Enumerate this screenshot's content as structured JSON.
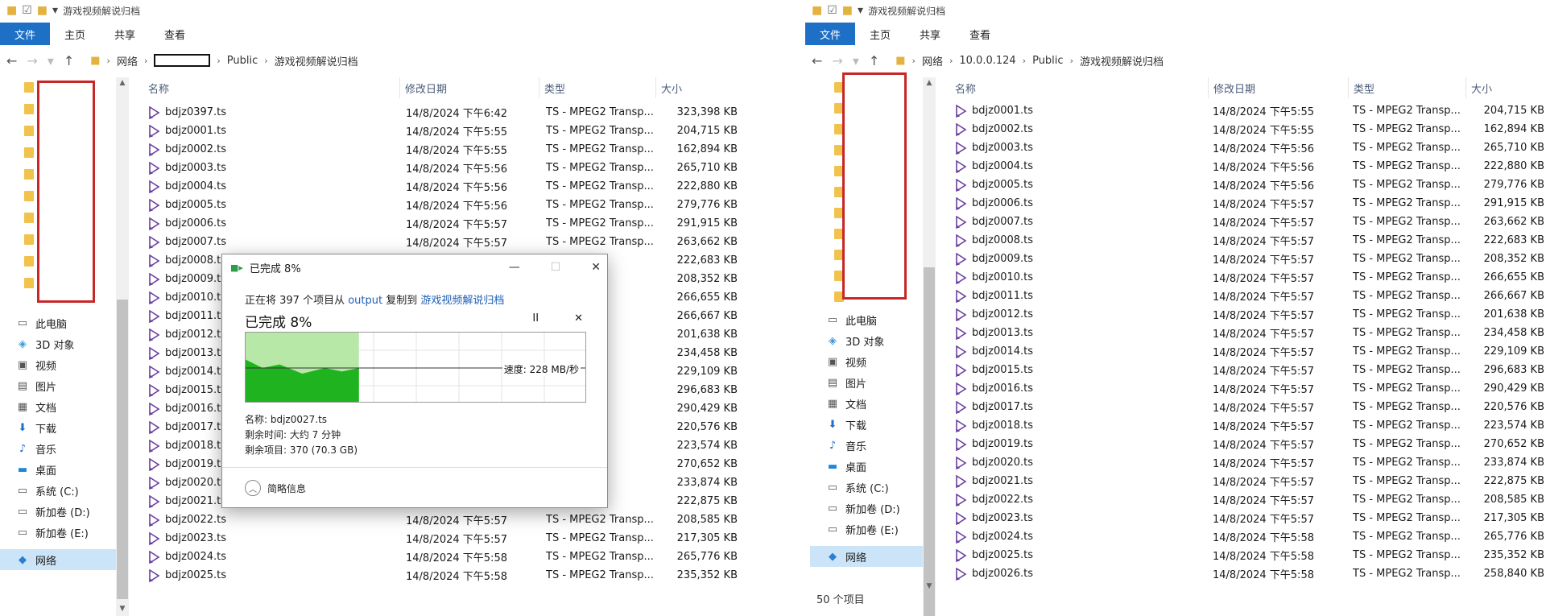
{
  "left": {
    "title": "游戏视频解说归档",
    "tabs": [
      "文件",
      "主页",
      "共享",
      "查看"
    ],
    "crumbs": [
      "网络",
      "Public",
      "游戏视频解说归档"
    ],
    "columns": {
      "name": "名称",
      "date": "修改日期",
      "type": "类型",
      "size": "大小"
    },
    "files": [
      {
        "name": "bdjz0397.ts",
        "date": "14/8/2024 下午6:42",
        "type": "TS - MPEG2 Transp...",
        "size": "323,398 KB"
      },
      {
        "name": "bdjz0001.ts",
        "date": "14/8/2024 下午5:55",
        "type": "TS - MPEG2 Transp...",
        "size": "204,715 KB"
      },
      {
        "name": "bdjz0002.ts",
        "date": "14/8/2024 下午5:55",
        "type": "TS - MPEG2 Transp...",
        "size": "162,894 KB"
      },
      {
        "name": "bdjz0003.ts",
        "date": "14/8/2024 下午5:56",
        "type": "TS - MPEG2 Transp...",
        "size": "265,710 KB"
      },
      {
        "name": "bdjz0004.ts",
        "date": "14/8/2024 下午5:56",
        "type": "TS - MPEG2 Transp...",
        "size": "222,880 KB"
      },
      {
        "name": "bdjz0005.ts",
        "date": "14/8/2024 下午5:56",
        "type": "TS - MPEG2 Transp...",
        "size": "279,776 KB"
      },
      {
        "name": "bdjz0006.ts",
        "date": "14/8/2024 下午5:57",
        "type": "TS - MPEG2 Transp...",
        "size": "291,915 KB"
      },
      {
        "name": "bdjz0007.ts",
        "date": "14/8/2024 下午5:57",
        "type": "TS - MPEG2 Transp...",
        "size": "263,662 KB"
      },
      {
        "name": "bdjz0008.ts",
        "date": "",
        "type": "",
        "size": "222,683 KB"
      },
      {
        "name": "bdjz0009.ts",
        "date": "",
        "type": "",
        "size": "208,352 KB"
      },
      {
        "name": "bdjz0010.ts",
        "date": "",
        "type": "",
        "size": "266,655 KB"
      },
      {
        "name": "bdjz0011.ts",
        "date": "",
        "type": "",
        "size": "266,667 KB"
      },
      {
        "name": "bdjz0012.ts",
        "date": "",
        "type": "",
        "size": "201,638 KB"
      },
      {
        "name": "bdjz0013.ts",
        "date": "",
        "type": "",
        "size": "234,458 KB"
      },
      {
        "name": "bdjz0014.ts",
        "date": "",
        "type": "",
        "size": "229,109 KB"
      },
      {
        "name": "bdjz0015.ts",
        "date": "",
        "type": "",
        "size": "296,683 KB"
      },
      {
        "name": "bdjz0016.ts",
        "date": "",
        "type": "",
        "size": "290,429 KB"
      },
      {
        "name": "bdjz0017.ts",
        "date": "",
        "type": "",
        "size": "220,576 KB"
      },
      {
        "name": "bdjz0018.ts",
        "date": "",
        "type": "",
        "size": "223,574 KB"
      },
      {
        "name": "bdjz0019.ts",
        "date": "",
        "type": "",
        "size": "270,652 KB"
      },
      {
        "name": "bdjz0020.ts",
        "date": "",
        "type": "",
        "size": "233,874 KB"
      },
      {
        "name": "bdjz0021.ts",
        "date": "",
        "type": "",
        "size": "222,875 KB"
      },
      {
        "name": "bdjz0022.ts",
        "date": "14/8/2024 下午5:57",
        "type": "TS - MPEG2 Transp...",
        "size": "208,585 KB"
      },
      {
        "name": "bdjz0023.ts",
        "date": "14/8/2024 下午5:57",
        "type": "TS - MPEG2 Transp...",
        "size": "217,305 KB"
      },
      {
        "name": "bdjz0024.ts",
        "date": "14/8/2024 下午5:58",
        "type": "TS - MPEG2 Transp...",
        "size": "265,776 KB"
      },
      {
        "name": "bdjz0025.ts",
        "date": "14/8/2024 下午5:58",
        "type": "TS - MPEG2 Transp...",
        "size": "235,352 KB"
      }
    ]
  },
  "right": {
    "title": "游戏视频解说归档",
    "tabs": [
      "文件",
      "主页",
      "共享",
      "查看"
    ],
    "crumbs": [
      "网络",
      "10.0.0.124",
      "Public",
      "游戏视频解说归档"
    ],
    "columns": {
      "name": "名称",
      "date": "修改日期",
      "type": "类型",
      "size": "大小"
    },
    "status": "50 个项目",
    "files": [
      {
        "name": "bdjz0001.ts",
        "date": "14/8/2024 下午5:55",
        "type": "TS - MPEG2 Transp...",
        "size": "204,715 KB"
      },
      {
        "name": "bdjz0002.ts",
        "date": "14/8/2024 下午5:55",
        "type": "TS - MPEG2 Transp...",
        "size": "162,894 KB"
      },
      {
        "name": "bdjz0003.ts",
        "date": "14/8/2024 下午5:56",
        "type": "TS - MPEG2 Transp...",
        "size": "265,710 KB"
      },
      {
        "name": "bdjz0004.ts",
        "date": "14/8/2024 下午5:56",
        "type": "TS - MPEG2 Transp...",
        "size": "222,880 KB"
      },
      {
        "name": "bdjz0005.ts",
        "date": "14/8/2024 下午5:56",
        "type": "TS - MPEG2 Transp...",
        "size": "279,776 KB"
      },
      {
        "name": "bdjz0006.ts",
        "date": "14/8/2024 下午5:57",
        "type": "TS - MPEG2 Transp...",
        "size": "291,915 KB"
      },
      {
        "name": "bdjz0007.ts",
        "date": "14/8/2024 下午5:57",
        "type": "TS - MPEG2 Transp...",
        "size": "263,662 KB"
      },
      {
        "name": "bdjz0008.ts",
        "date": "14/8/2024 下午5:57",
        "type": "TS - MPEG2 Transp...",
        "size": "222,683 KB"
      },
      {
        "name": "bdjz0009.ts",
        "date": "14/8/2024 下午5:57",
        "type": "TS - MPEG2 Transp...",
        "size": "208,352 KB"
      },
      {
        "name": "bdjz0010.ts",
        "date": "14/8/2024 下午5:57",
        "type": "TS - MPEG2 Transp...",
        "size": "266,655 KB"
      },
      {
        "name": "bdjz0011.ts",
        "date": "14/8/2024 下午5:57",
        "type": "TS - MPEG2 Transp...",
        "size": "266,667 KB"
      },
      {
        "name": "bdjz0012.ts",
        "date": "14/8/2024 下午5:57",
        "type": "TS - MPEG2 Transp...",
        "size": "201,638 KB"
      },
      {
        "name": "bdjz0013.ts",
        "date": "14/8/2024 下午5:57",
        "type": "TS - MPEG2 Transp...",
        "size": "234,458 KB"
      },
      {
        "name": "bdjz0014.ts",
        "date": "14/8/2024 下午5:57",
        "type": "TS - MPEG2 Transp...",
        "size": "229,109 KB"
      },
      {
        "name": "bdjz0015.ts",
        "date": "14/8/2024 下午5:57",
        "type": "TS - MPEG2 Transp...",
        "size": "296,683 KB"
      },
      {
        "name": "bdjz0016.ts",
        "date": "14/8/2024 下午5:57",
        "type": "TS - MPEG2 Transp...",
        "size": "290,429 KB"
      },
      {
        "name": "bdjz0017.ts",
        "date": "14/8/2024 下午5:57",
        "type": "TS - MPEG2 Transp...",
        "size": "220,576 KB"
      },
      {
        "name": "bdjz0018.ts",
        "date": "14/8/2024 下午5:57",
        "type": "TS - MPEG2 Transp...",
        "size": "223,574 KB"
      },
      {
        "name": "bdjz0019.ts",
        "date": "14/8/2024 下午5:57",
        "type": "TS - MPEG2 Transp...",
        "size": "270,652 KB"
      },
      {
        "name": "bdjz0020.ts",
        "date": "14/8/2024 下午5:57",
        "type": "TS - MPEG2 Transp...",
        "size": "233,874 KB"
      },
      {
        "name": "bdjz0021.ts",
        "date": "14/8/2024 下午5:57",
        "type": "TS - MPEG2 Transp...",
        "size": "222,875 KB"
      },
      {
        "name": "bdjz0022.ts",
        "date": "14/8/2024 下午5:57",
        "type": "TS - MPEG2 Transp...",
        "size": "208,585 KB"
      },
      {
        "name": "bdjz0023.ts",
        "date": "14/8/2024 下午5:57",
        "type": "TS - MPEG2 Transp...",
        "size": "217,305 KB"
      },
      {
        "name": "bdjz0024.ts",
        "date": "14/8/2024 下午5:58",
        "type": "TS - MPEG2 Transp...",
        "size": "265,776 KB"
      },
      {
        "name": "bdjz0025.ts",
        "date": "14/8/2024 下午5:58",
        "type": "TS - MPEG2 Transp...",
        "size": "235,352 KB"
      },
      {
        "name": "bdjz0026.ts",
        "date": "14/8/2024 下午5:58",
        "type": "TS - MPEG2 Transp...",
        "size": "258,840 KB"
      }
    ]
  },
  "nav": [
    {
      "label": "此电脑",
      "icon": "computer-icon"
    },
    {
      "label": "3D 对象",
      "icon": "cube-3d-icon"
    },
    {
      "label": "视频",
      "icon": "video-icon"
    },
    {
      "label": "图片",
      "icon": "picture-icon"
    },
    {
      "label": "文档",
      "icon": "document-icon"
    },
    {
      "label": "下载",
      "icon": "download-icon"
    },
    {
      "label": "音乐",
      "icon": "music-icon"
    },
    {
      "label": "桌面",
      "icon": "desktop-icon"
    },
    {
      "label": "系统 (C:)",
      "icon": "drive-icon"
    },
    {
      "label": "新加卷 (D:)",
      "icon": "drive-icon"
    },
    {
      "label": "新加卷 (E:)",
      "icon": "drive-icon"
    },
    {
      "label": "网络",
      "icon": "network-icon"
    }
  ],
  "dialog": {
    "title": "已完成 8%",
    "copy_prefix": "正在将 397 个项目从",
    "source": "output",
    "copy_mid": "复制到",
    "dest": "游戏视频解说归档",
    "heading": "已完成 8%",
    "speed": "速度: 228 MB/秒",
    "name_line": "名称: bdjz0027.ts",
    "time_line": "剩余时间: 大约 7 分钟",
    "items_line": "剩余项目: 370 (70.3 GB)",
    "more": "简略信息",
    "progress": 0.08
  },
  "colors": {
    "accent": "#1e6fc6",
    "red_mask": "#c62828",
    "graph_green": "#1fb31f"
  }
}
